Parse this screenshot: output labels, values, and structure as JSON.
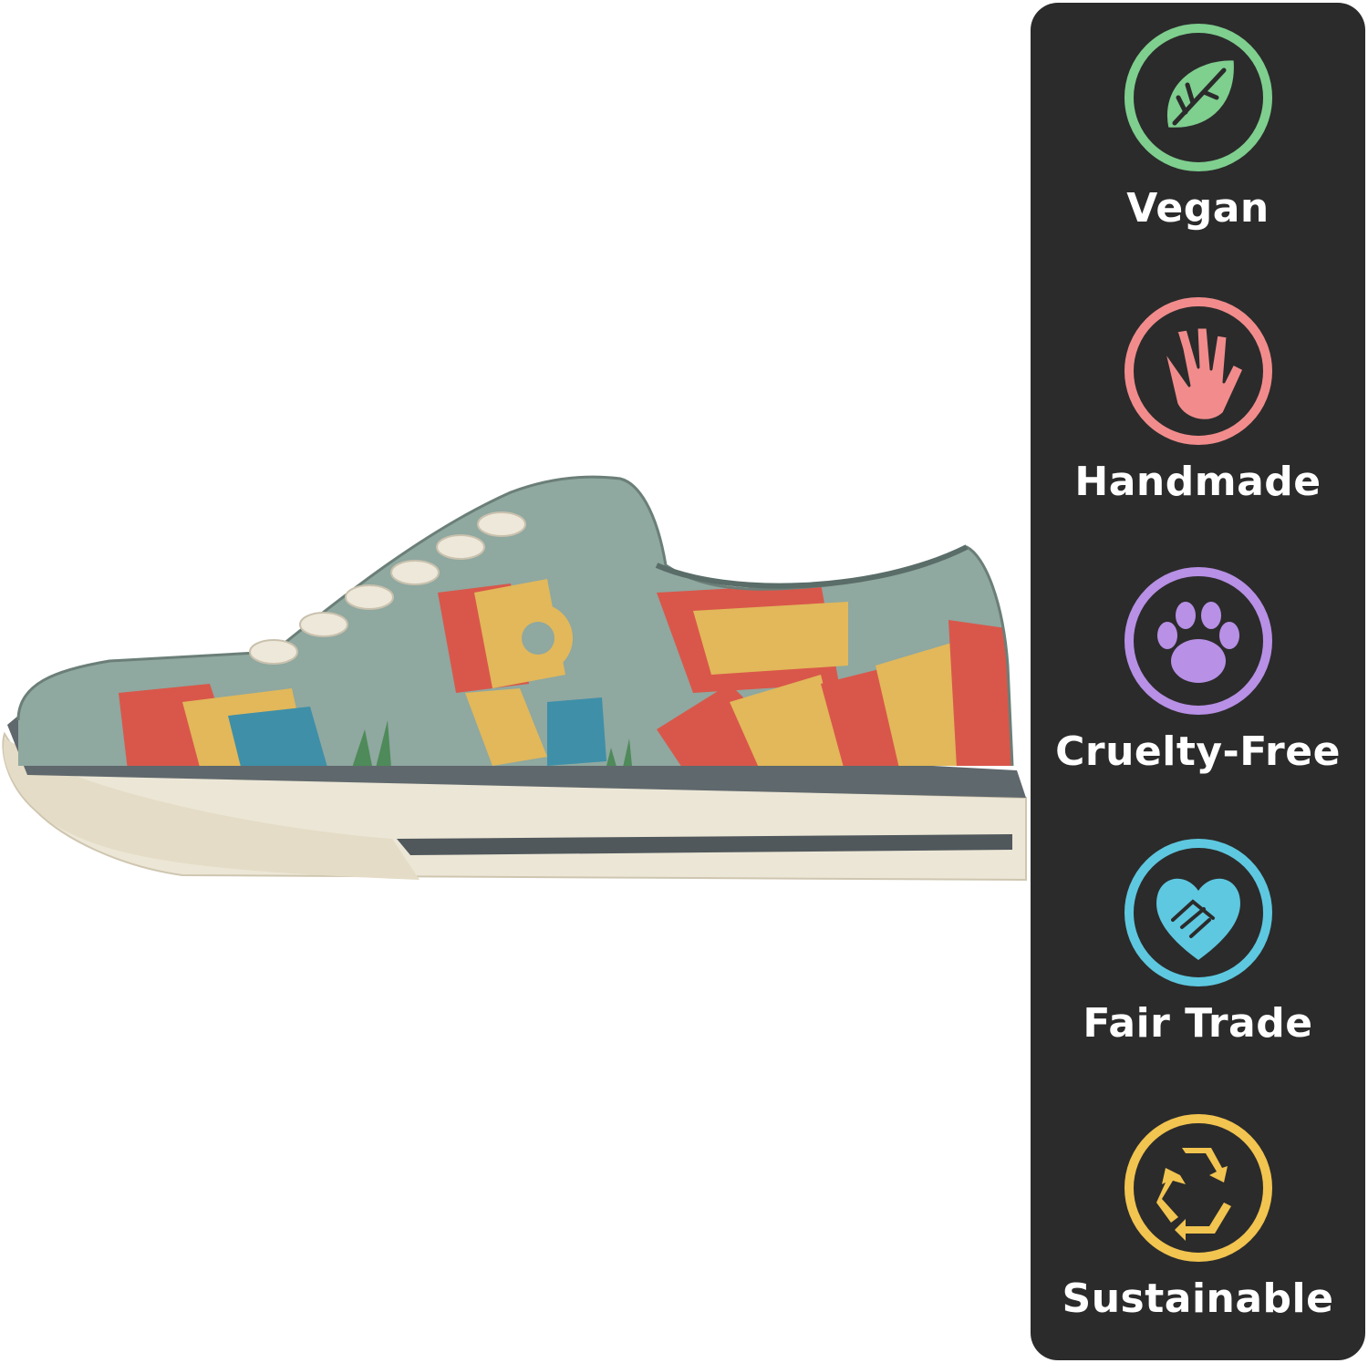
{
  "product_image": {
    "subject": "low-top lace-up sneaker with colorful LOVE print",
    "colors": {
      "upper_base": "#8fa8a0",
      "sole": "#ece6d6",
      "midsole_stripe": "#50585c",
      "accent_red": "#d9574a",
      "accent_yellow": "#e2b85a",
      "accent_blue": "#3f8fa8"
    }
  },
  "badges": [
    {
      "label": "Vegan",
      "icon": "leaf-icon",
      "color": "#7fcf8f"
    },
    {
      "label": "Handmade",
      "icon": "hand-icon",
      "color": "#f28c8c"
    },
    {
      "label": "Cruelty-Free",
      "icon": "paw-icon",
      "color": "#b890e6"
    },
    {
      "label": "Fair Trade",
      "icon": "handshake-heart-icon",
      "color": "#5ec8e0"
    },
    {
      "label": "Sustainable",
      "icon": "recycle-icon",
      "color": "#f2c450"
    }
  ],
  "panel": {
    "background": "#2b2b2b"
  }
}
